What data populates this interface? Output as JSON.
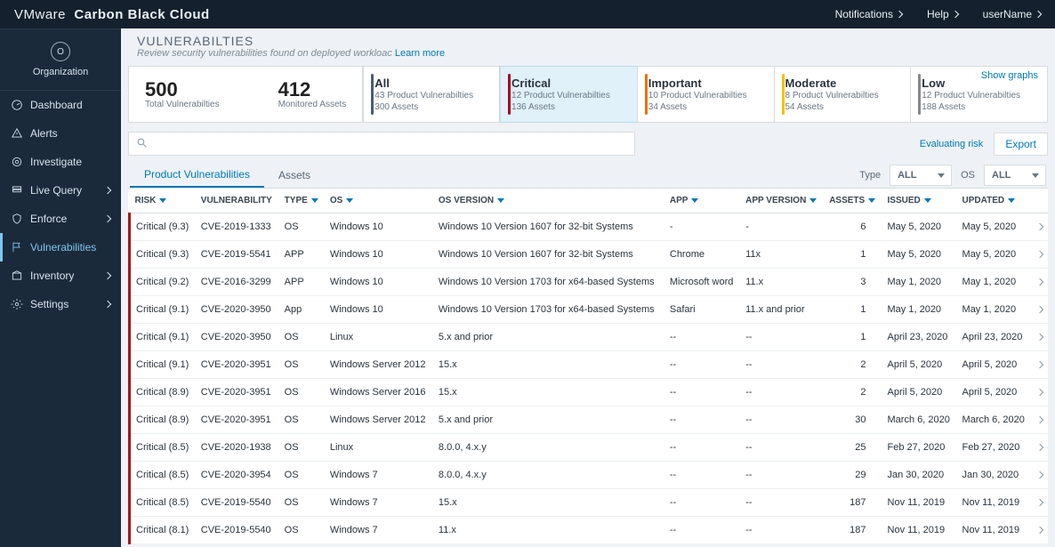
{
  "brand": {
    "prefix": "VMware",
    "product": "Carbon Black Cloud"
  },
  "top_links": {
    "notifications": "Notifications",
    "help": "Help",
    "user": "userName"
  },
  "org": {
    "initial": "O",
    "label": "Organization"
  },
  "nav": [
    {
      "id": "dashboard",
      "label": "Dashboard",
      "icon": "gauge",
      "expand": false,
      "active": false
    },
    {
      "id": "alerts",
      "label": "Alerts",
      "icon": "alert",
      "expand": false,
      "active": false
    },
    {
      "id": "investigate",
      "label": "Investigate",
      "icon": "target",
      "expand": false,
      "active": false
    },
    {
      "id": "livequery",
      "label": "Live Query",
      "icon": "stack",
      "expand": true,
      "active": false
    },
    {
      "id": "enforce",
      "label": "Enforce",
      "icon": "shield",
      "expand": true,
      "active": false
    },
    {
      "id": "vulnerabilities",
      "label": "Vulnerabilities",
      "icon": "flag",
      "expand": false,
      "active": true
    },
    {
      "id": "inventory",
      "label": "Inventory",
      "icon": "box",
      "expand": true,
      "active": false
    },
    {
      "id": "settings",
      "label": "Settings",
      "icon": "gear",
      "expand": true,
      "active": false
    }
  ],
  "page": {
    "title": "VULNERABILTIES",
    "subtitle": "Review security vulnerabilities found on deployed workloac",
    "learn_more": "Learn more"
  },
  "summary": {
    "total_vuln": {
      "value": "500",
      "label": "Total Vulnerabilties"
    },
    "monitored": {
      "value": "412",
      "label": "Monitored Assets"
    },
    "show_graphs": "Show graphs",
    "severities": [
      {
        "key": "all",
        "name": "All",
        "l1": "43  Product Vulnerabilties",
        "l2": "300 Assets",
        "selected": false
      },
      {
        "key": "critical",
        "name": "Critical",
        "l1": "12 Product Vulnerabilties",
        "l2": "136 Assets",
        "selected": true
      },
      {
        "key": "important",
        "name": "Important",
        "l1": "10 Product Vulnerabilties",
        "l2": "34 Assets",
        "selected": false
      },
      {
        "key": "moderate",
        "name": "Moderate",
        "l1": "8 Product Vulnerabilties",
        "l2": "54 Assets",
        "selected": false
      },
      {
        "key": "low",
        "name": "Low",
        "l1": "12 Product Vulnerabilties",
        "l2": "188 Assets",
        "selected": false
      }
    ]
  },
  "toolbar": {
    "search_placeholder": "",
    "evaluating": "Evaluating risk",
    "export": "Export"
  },
  "tabs": {
    "pv": "Product Vulnerabilities",
    "assets": "Assets"
  },
  "filters": {
    "type_label": "Type",
    "type_value": "ALL",
    "os_label": "OS",
    "os_value": "ALL"
  },
  "columns": {
    "risk": "RISK",
    "vuln": "VULNERABILITY",
    "type": "TYPE",
    "os": "OS",
    "osver": "OS VERSION",
    "app": "APP",
    "appver": "APP VERSION",
    "assets": "ASSETS",
    "issued": "ISSUED",
    "updated": "UPDATED"
  },
  "rows": [
    {
      "risk": "Critical (9.3)",
      "vuln": "CVE-2019-1333",
      "type": "OS",
      "os": "Windows 10",
      "osver": "Windows 10 Version 1607 for 32-bit Systems",
      "app": "-",
      "appver": "-",
      "assets": "6",
      "issued": "May 5, 2020",
      "updated": "May 5, 2020"
    },
    {
      "risk": "Critical (9.3)",
      "vuln": "CVE-2019-5541",
      "type": "APP",
      "os": "Windows 10",
      "osver": "Windows 10 Version 1607 for 32-bit Systems",
      "app": "Chrome",
      "appver": "11x",
      "assets": "1",
      "issued": "May 5, 2020",
      "updated": "May 5, 2020"
    },
    {
      "risk": "Critical (9.2)",
      "vuln": "CVE-2016-3299",
      "type": "APP",
      "os": "Windows 10",
      "osver": "Windows 10 Version 1703 for x64-based Systems",
      "app": "Microsoft word",
      "appver": "11.x",
      "assets": "3",
      "issued": "May 1, 2020",
      "updated": "May 1, 2020"
    },
    {
      "risk": "Critical (9.1)",
      "vuln": "CVE-2020-3950",
      "type": "App",
      "os": "Windows 10",
      "osver": "Windows 10 Version 1703 for x64-based Systems",
      "app": "Safari",
      "appver": "11.x and prior",
      "assets": "1",
      "issued": "May 1, 2020",
      "updated": "May 1, 2020"
    },
    {
      "risk": "Critical (9.1)",
      "vuln": "CVE-2020-3950",
      "type": "OS",
      "os": "Linux",
      "osver": "5.x and prior",
      "app": "--",
      "appver": "--",
      "assets": "1",
      "issued": "April 23, 2020",
      "updated": "April 23, 2020"
    },
    {
      "risk": "Critical (9.1)",
      "vuln": "CVE-2020-3951",
      "type": "OS",
      "os": "Windows Server 2012",
      "osver": "15.x",
      "app": "--",
      "appver": "--",
      "assets": "2",
      "issued": "April 5, 2020",
      "updated": "April 5, 2020"
    },
    {
      "risk": "Critical (8.9)",
      "vuln": "CVE-2020-3951",
      "type": "OS",
      "os": "Windows Server 2016",
      "osver": "15.x",
      "app": "--",
      "appver": "--",
      "assets": "2",
      "issued": "April 5, 2020",
      "updated": "April 5, 2020"
    },
    {
      "risk": "Critical (8.9)",
      "vuln": "CVE-2020-3951",
      "type": "OS",
      "os": "Windows Server 2012",
      "osver": "5.x and prior",
      "app": "--",
      "appver": "--",
      "assets": "30",
      "issued": "March 6, 2020",
      "updated": "March 6, 2020"
    },
    {
      "risk": "Critical (8.5)",
      "vuln": "CVE-2020-1938",
      "type": "OS",
      "os": "Linux",
      "osver": "8.0.0, 4.x.y",
      "app": "--",
      "appver": "--",
      "assets": "25",
      "issued": "Feb 27, 2020",
      "updated": "Feb 27, 2020"
    },
    {
      "risk": "Critical (8.5)",
      "vuln": "CVE-2020-3954",
      "type": "OS",
      "os": "Windows 7",
      "osver": "8.0.0, 4.x.y",
      "app": "--",
      "appver": "--",
      "assets": "29",
      "issued": "Jan 30, 2020",
      "updated": "Jan 30, 2020"
    },
    {
      "risk": "Critical (8.5)",
      "vuln": "CVE-2019-5540",
      "type": "OS",
      "os": "Windows 7",
      "osver": "15.x",
      "app": "--",
      "appver": "--",
      "assets": "187",
      "issued": "Nov 11, 2019",
      "updated": "Nov 11, 2019"
    },
    {
      "risk": "Critical (8.1)",
      "vuln": "CVE-2019-5540",
      "type": "OS",
      "os": "Windows 7",
      "osver": "11.x",
      "app": "--",
      "appver": "--",
      "assets": "187",
      "issued": "Nov 11, 2019",
      "updated": "Nov 11, 2019"
    }
  ]
}
